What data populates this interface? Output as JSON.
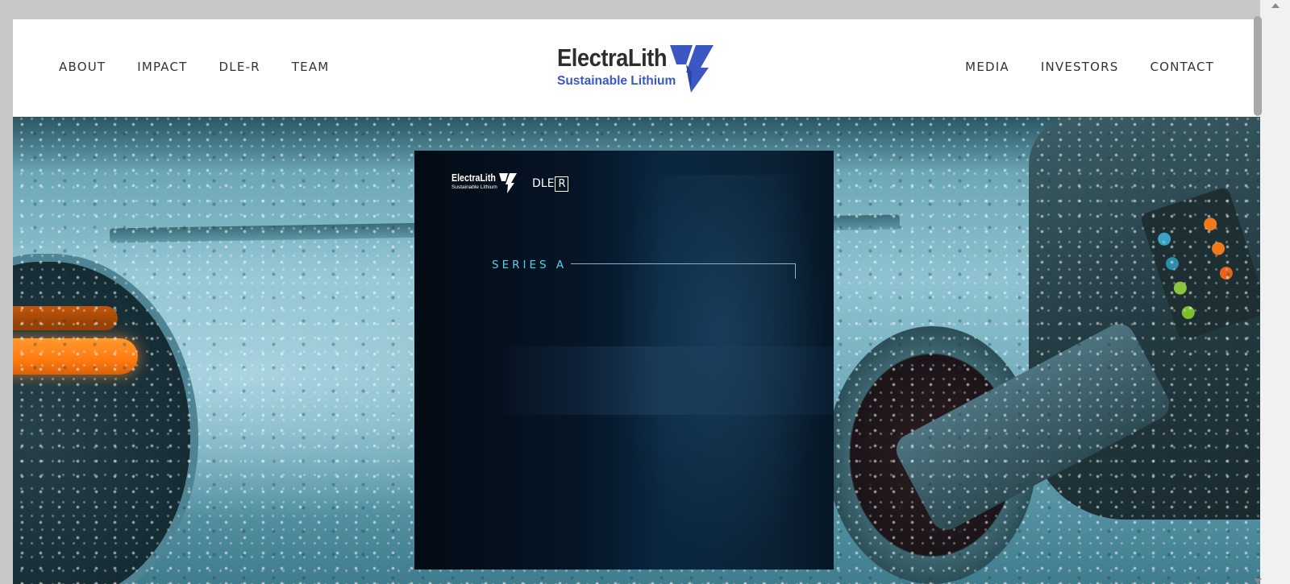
{
  "header": {
    "logo": {
      "name": "ElectraLith",
      "tagline": "Sustainable Lithium",
      "icon": "lightning-bolt-icon",
      "brand_color": "#3b57c4"
    },
    "nav_left": [
      {
        "label": "ABOUT"
      },
      {
        "label": "IMPACT"
      },
      {
        "label": "DLE-R"
      },
      {
        "label": "TEAM"
      }
    ],
    "nav_right": [
      {
        "label": "MEDIA"
      },
      {
        "label": "INVESTORS"
      },
      {
        "label": "CONTACT"
      }
    ]
  },
  "hero": {
    "background": "rain-covered electric car being charged",
    "card": {
      "logo_name": "ElectraLith",
      "logo_tagline": "Sustainable Lithium",
      "dle_prefix": "DLE",
      "dle_boxed": "R",
      "heading": "SERIES A",
      "accent_color": "#4fd3e6"
    }
  },
  "colors": {
    "nav_text": "#333333",
    "card_bg": "#061527"
  }
}
